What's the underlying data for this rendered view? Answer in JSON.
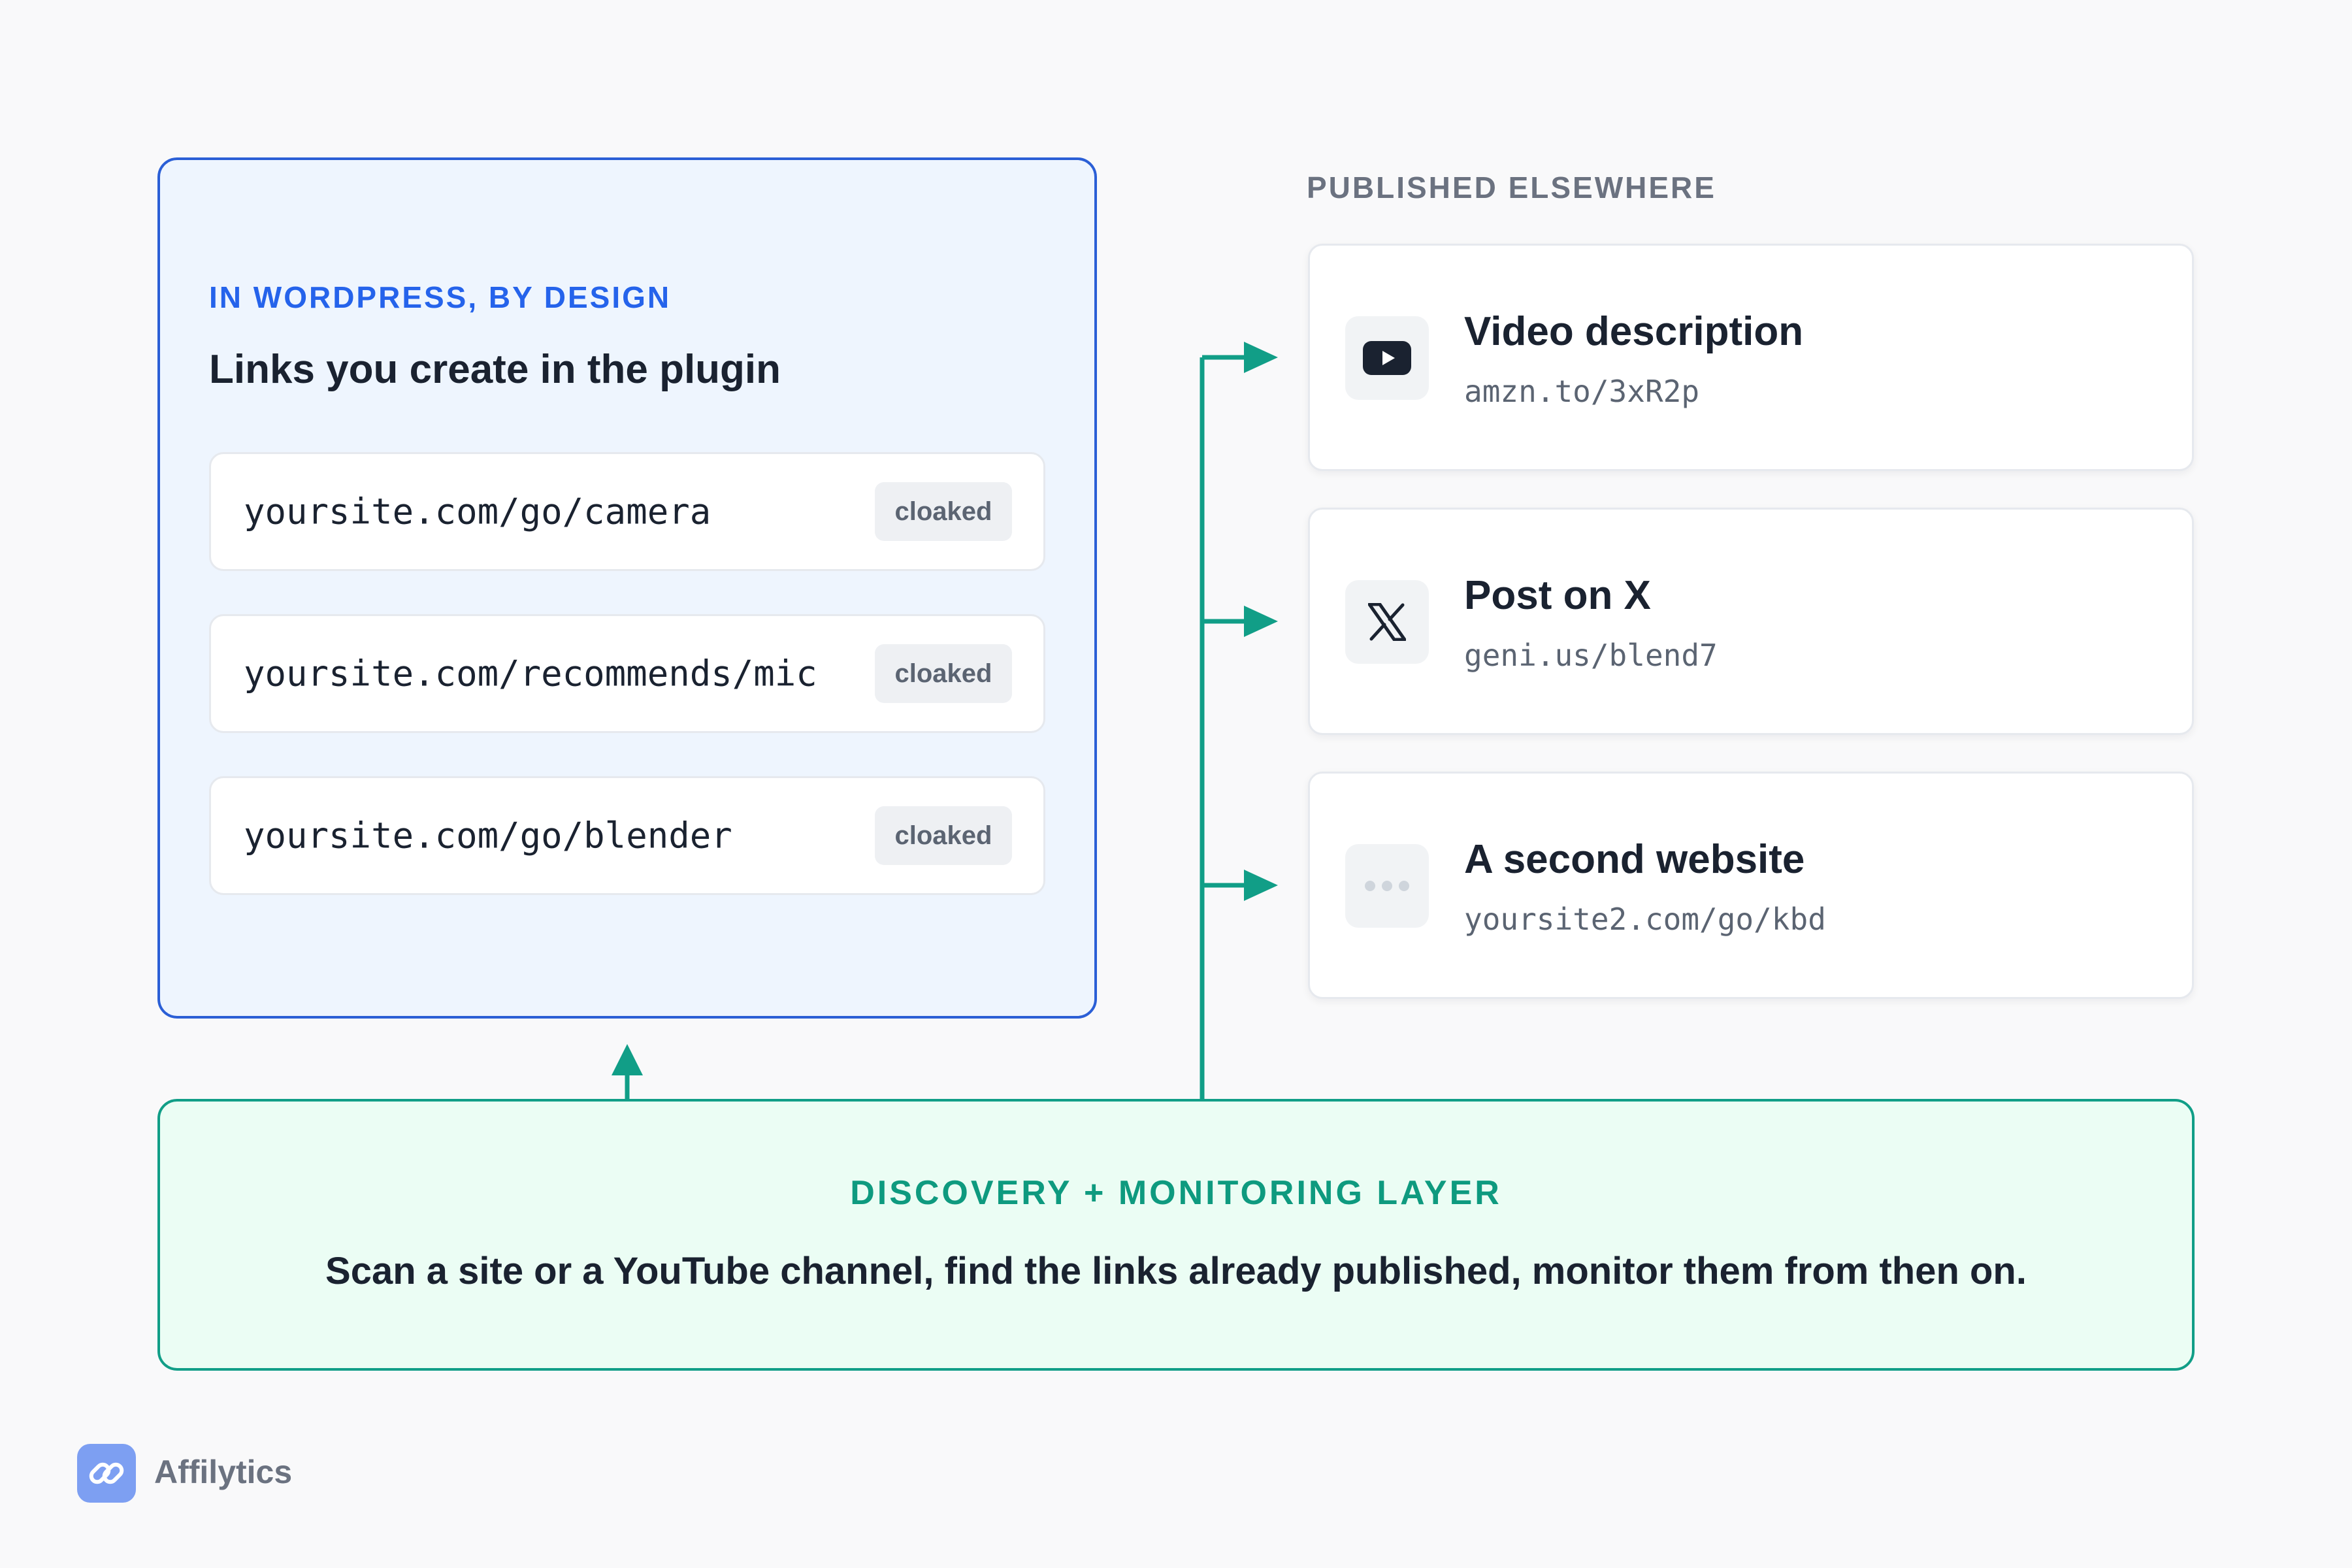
{
  "wordpress_panel": {
    "eyebrow": "IN WORDPRESS, BY DESIGN",
    "title": "Links you create in the plugin",
    "links": [
      {
        "url": "yoursite.com/go/camera",
        "badge": "cloaked"
      },
      {
        "url": "yoursite.com/recommends/mic",
        "badge": "cloaked"
      },
      {
        "url": "yoursite.com/go/blender",
        "badge": "cloaked"
      }
    ]
  },
  "published_panel": {
    "eyebrow": "PUBLISHED ELSEWHERE",
    "items": [
      {
        "icon": "youtube-icon",
        "title": "Video description",
        "url": "amzn.to/3xR2p"
      },
      {
        "icon": "x-logo-icon",
        "title": "Post on X",
        "url": "geni.us/blend7"
      },
      {
        "icon": "more-dots-icon",
        "title": "A second website",
        "url": "yoursite2.com/go/kbd"
      }
    ]
  },
  "discovery_panel": {
    "eyebrow": "DISCOVERY + MONITORING LAYER",
    "text": "Scan a site or a YouTube channel, find the links already published, monitor them from then on."
  },
  "brand": {
    "name": "Affilytics",
    "logo_icon": "chain-link-icon"
  },
  "colors": {
    "blue_accent": "#2563eb",
    "teal_accent": "#0e9a7f",
    "connector": "#119e87"
  }
}
